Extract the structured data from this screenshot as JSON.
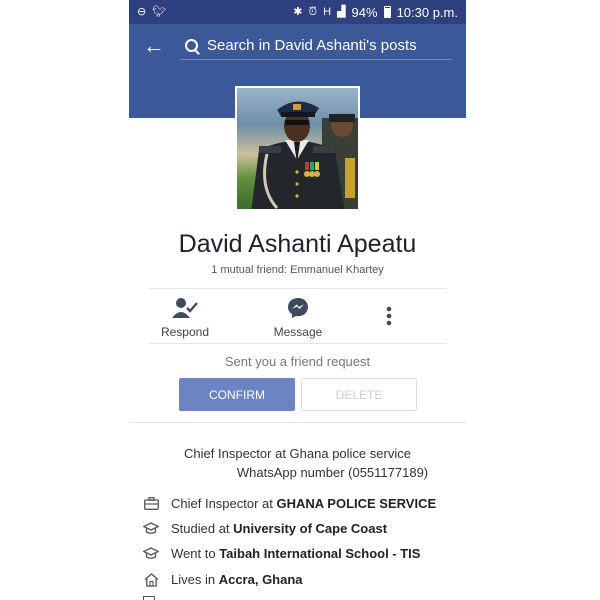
{
  "status_bar": {
    "time": "10:30 p.m.",
    "battery": "94%",
    "left_icons": [
      "minus-circle-icon",
      "twitter-icon"
    ],
    "right_icons": [
      "bluetooth-icon",
      "alarm-icon",
      "h-network-icon",
      "signal-icon",
      "battery-icon"
    ]
  },
  "header": {
    "search_placeholder": "Search in David Ashanti's posts",
    "color": "#3b5998"
  },
  "profile": {
    "name": "David Ashanti Apeatu",
    "mutual_friend": "1 mutual friend: Emmanuel Khartey"
  },
  "actions": [
    {
      "label": "Respond",
      "icon": "respond-person-check-icon"
    },
    {
      "label": "Message",
      "icon": "messenger-icon"
    },
    {
      "label": "",
      "icon": "more-vertical-icon"
    }
  ],
  "request": {
    "text": "Sent you a friend request",
    "confirm_label": "CONFIRM",
    "delete_label": "DELETE"
  },
  "bio": {
    "line1": "Chief Inspector at Ghana police service",
    "line2": "WhatsApp number (0551177189)"
  },
  "details": [
    {
      "icon": "briefcase-icon",
      "prefix": "Chief Inspector at ",
      "bold": "GHANA POLICE SERVICE"
    },
    {
      "icon": "graduation-cap-icon",
      "prefix": "Studied at ",
      "bold": "University of Cape Coast"
    },
    {
      "icon": "graduation-cap-icon",
      "prefix": "Went to ",
      "bold": "Taibah International School - TIS"
    },
    {
      "icon": "home-icon",
      "prefix": "Lives in ",
      "bold": "Accra, Ghana"
    }
  ],
  "colors": {
    "accent": "#3b5998",
    "confirm_button": "#6d84c4"
  }
}
